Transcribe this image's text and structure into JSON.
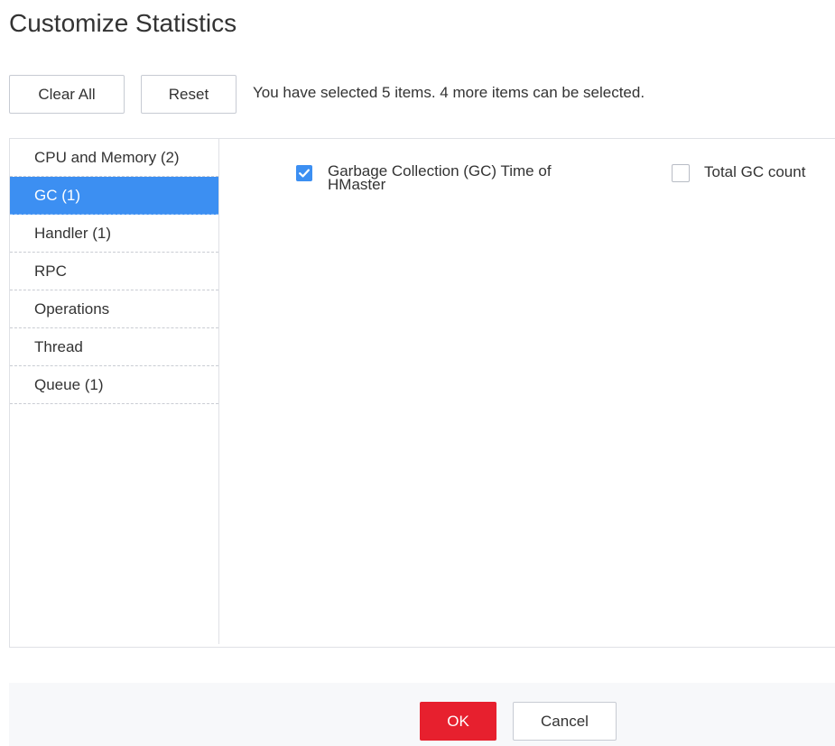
{
  "dialog": {
    "title": "Customize Statistics"
  },
  "toolbar": {
    "clear_all_label": "Clear All",
    "reset_label": "Reset",
    "selection_hint": "You have selected 5 items. 4 more items can be selected."
  },
  "categories": [
    {
      "label": "CPU and Memory (2)",
      "active": false
    },
    {
      "label": "GC (1)",
      "active": true
    },
    {
      "label": "Handler (1)",
      "active": false
    },
    {
      "label": "RPC",
      "active": false
    },
    {
      "label": "Operations",
      "active": false
    },
    {
      "label": "Thread",
      "active": false
    },
    {
      "label": "Queue (1)",
      "active": false
    }
  ],
  "metrics": [
    {
      "label": "Garbage Collection (GC) Time of HMaster",
      "checked": true,
      "icon": "checkmark-icon"
    },
    {
      "label": "Total GC count",
      "checked": false
    }
  ],
  "footer": {
    "ok_label": "OK",
    "cancel_label": "Cancel"
  },
  "colors": {
    "accent": "#3c8ff2",
    "primary_button": "#e7202e",
    "footer_bg": "#f7f8fa"
  }
}
